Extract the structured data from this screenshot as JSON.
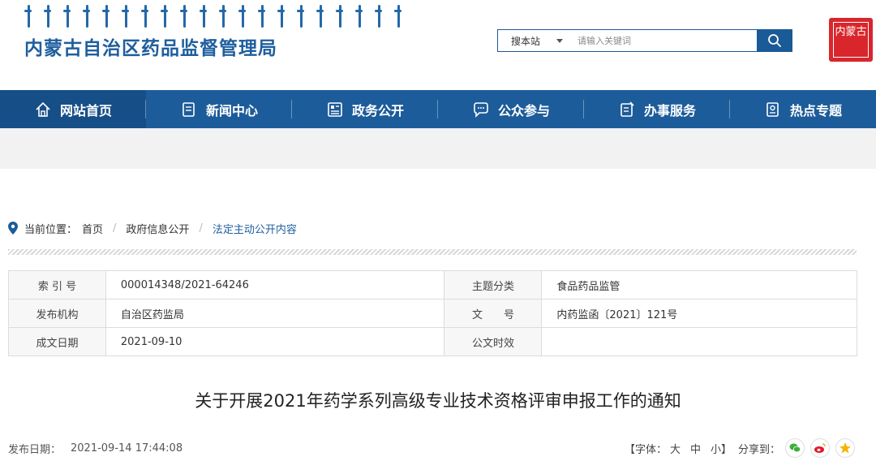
{
  "header": {
    "site_title": "内蒙古自治区药品监督管理局",
    "search": {
      "scope": "搜本站",
      "placeholder": "请输入关键词"
    },
    "seal_text": "内蒙古"
  },
  "nav": {
    "items": [
      {
        "label": "网站首页",
        "icon": "home-icon",
        "active": true
      },
      {
        "label": "新闻中心",
        "icon": "news-icon"
      },
      {
        "label": "政务公开",
        "icon": "gov-info-icon"
      },
      {
        "label": "公众参与",
        "icon": "chat-icon"
      },
      {
        "label": "办事服务",
        "icon": "service-icon"
      },
      {
        "label": "热点专题",
        "icon": "topic-icon"
      }
    ]
  },
  "breadcrumb": {
    "prefix": "当前位置：",
    "items": [
      "首页",
      "政府信息公开",
      "法定主动公开内容"
    ]
  },
  "meta_table": {
    "rows": [
      {
        "l1": "索 引 号",
        "v1": "000014348/2021-64246",
        "l2": "主题分类",
        "v2": "食品药品监管"
      },
      {
        "l1": "发布机构",
        "v1": "自治区药监局",
        "l2": "文　　号",
        "v2": "内药监函〔2021〕121号"
      },
      {
        "l1": "成文日期",
        "v1": "2021-09-10",
        "l2": "公文时效",
        "v2": ""
      }
    ]
  },
  "document": {
    "title": "关于开展2021年药学系列高级专业技术资格评审申报工作的通知",
    "publish_label": "发布日期：",
    "publish_date": "2021-09-14 17:44:08",
    "font_label": "【字体：",
    "font_large": "大",
    "font_medium": "中",
    "font_small": "小】",
    "share_label": "分享到："
  },
  "colors": {
    "brand": "#1d5c9a",
    "seal": "#d9262c"
  }
}
